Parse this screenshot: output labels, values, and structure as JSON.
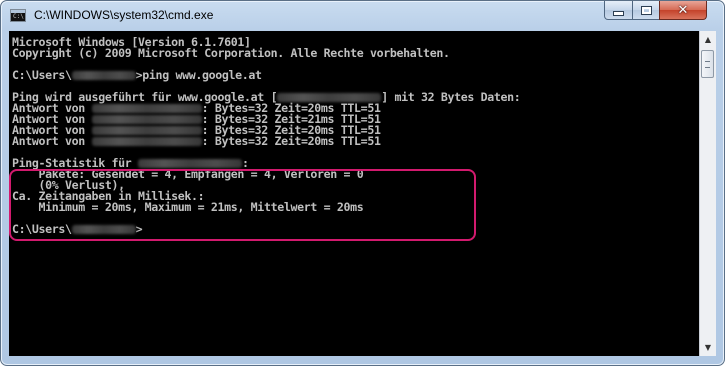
{
  "window": {
    "title": "C:\\WINDOWS\\system32\\cmd.exe",
    "icon": "cmd-icon",
    "controls": {
      "minimize": "minimize-icon",
      "maximize": "maximize-icon",
      "close": "close-icon"
    }
  },
  "console": {
    "lines": [
      "Microsoft Windows [Version 6.1.7601]",
      "Copyright (c) 2009 Microsoft Corporation. Alle Rechte vorbehalten.",
      "",
      {
        "before": "C:\\Users\\",
        "redacted": "user",
        "after": ">ping www.google.at"
      },
      "",
      {
        "before": "Ping wird ausgeführt für www.google.at [",
        "redacted": "ip",
        "after": "] mit 32 Bytes Daten:"
      },
      {
        "before": "Antwort von ",
        "redacted": "ip2",
        "after": ": Bytes=32 Zeit=20ms TTL=51"
      },
      {
        "before": "Antwort von ",
        "redacted": "ip2",
        "after": ": Bytes=32 Zeit=21ms TTL=51"
      },
      {
        "before": "Antwort von ",
        "redacted": "ip2",
        "after": ": Bytes=32 Zeit=20ms TTL=51"
      },
      {
        "before": "Antwort von ",
        "redacted": "ip2",
        "after": ": Bytes=32 Zeit=20ms TTL=51"
      },
      "",
      {
        "before": "Ping-Statistik für ",
        "redacted": "ip",
        "after": ":"
      },
      "    Pakete: Gesendet = 4, Empfangen = 4, Verloren = 0",
      "    (0% Verlust),",
      "Ca. Zeitangaben in Millisek.:",
      "    Minimum = 20ms, Maximum = 21ms, Mittelwert = 20ms",
      "",
      {
        "before": "C:\\Users\\",
        "redacted": "user",
        "after": ">"
      }
    ],
    "text_color": "#c0c0c0",
    "background": "#000000",
    "highlight_color": "#d21a6e"
  },
  "scrollbar": {
    "up": "arrow-up-icon",
    "down": "arrow-down-icon"
  }
}
